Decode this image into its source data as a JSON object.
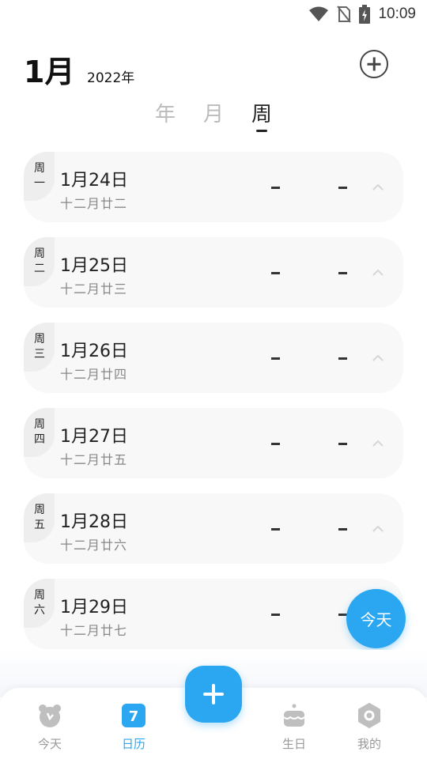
{
  "status_bar": {
    "time": "10:09",
    "icons": [
      "wifi-icon",
      "no-sim-icon",
      "battery-charging-icon"
    ]
  },
  "header": {
    "month": "1月",
    "year": "2022年",
    "add_icon": "add-circle-icon"
  },
  "view_tabs": [
    {
      "label": "年",
      "active": false
    },
    {
      "label": "月",
      "active": false
    },
    {
      "label": "周",
      "active": true
    }
  ],
  "days": [
    {
      "weekday": "周一",
      "date": "1月24日",
      "lunar": "十二月廿二",
      "slot1": "-",
      "slot2": "-"
    },
    {
      "weekday": "周二",
      "date": "1月25日",
      "lunar": "十二月廿三",
      "slot1": "-",
      "slot2": "-"
    },
    {
      "weekday": "周三",
      "date": "1月26日",
      "lunar": "十二月廿四",
      "slot1": "-",
      "slot2": "-"
    },
    {
      "weekday": "周四",
      "date": "1月27日",
      "lunar": "十二月廿五",
      "slot1": "-",
      "slot2": "-"
    },
    {
      "weekday": "周五",
      "date": "1月28日",
      "lunar": "十二月廿六",
      "slot1": "-",
      "slot2": "-"
    },
    {
      "weekday": "周六",
      "date": "1月29日",
      "lunar": "十二月廿七",
      "slot1": "-",
      "slot2": "-"
    }
  ],
  "today_button": {
    "label": "今天"
  },
  "bottom_nav": {
    "items": [
      {
        "label": "今天",
        "icon": "bear-clock-icon",
        "active": false
      },
      {
        "label": "日历",
        "icon": "calendar-icon",
        "active": true,
        "badge": "7"
      },
      {
        "label": "生日",
        "icon": "cake-icon",
        "active": false
      },
      {
        "label": "我的",
        "icon": "profile-gear-icon",
        "active": false
      }
    ],
    "center_icon": "plus-icon"
  },
  "colors": {
    "accent": "#2aa7f0",
    "card_bg": "#f8f8f8",
    "weekday_tab_bg": "#eeeeee",
    "inactive_text": "#999999"
  }
}
